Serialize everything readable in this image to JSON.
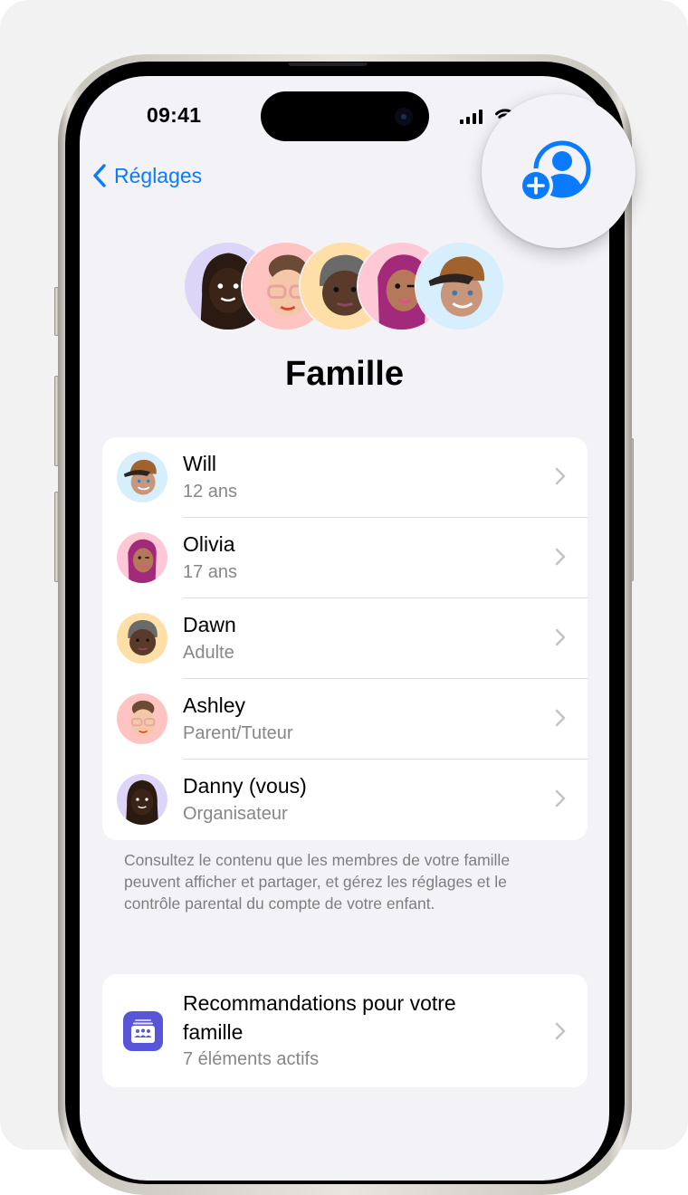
{
  "status_bar": {
    "time": "09:41",
    "icons": [
      "signal-icon",
      "wifi-icon"
    ]
  },
  "nav": {
    "back_label": "Réglages",
    "back_icon": "chevron-left-icon",
    "add_member_icon": "person-add-icon"
  },
  "header": {
    "title": "Famille",
    "avatar_backgrounds": [
      "#ddd5f7",
      "#ffc4c1",
      "#ffdfa8",
      "#ffc8d6",
      "#d7eefc"
    ]
  },
  "members": [
    {
      "name": "Will",
      "role": "12 ans",
      "avatar_bg": "#d7eefc"
    },
    {
      "name": "Olivia",
      "role": "17 ans",
      "avatar_bg": "#ffc8d6"
    },
    {
      "name": "Dawn",
      "role": "Adulte",
      "avatar_bg": "#ffdfa8"
    },
    {
      "name": "Ashley",
      "role": "Parent/Tuteur",
      "avatar_bg": "#ffc4c1"
    },
    {
      "name": "Danny (vous)",
      "role": "Organisateur",
      "avatar_bg": "#ddd5f7"
    }
  ],
  "footnote": "Consultez le contenu que les membres de votre famille peuvent afficher et partager, et gérez les réglages et le contrôle parental du compte de votre enfant.",
  "recommendations": {
    "title": "Recommandations pour votre famille",
    "subtitle": "7 éléments actifs",
    "icon": "family-checklist-icon"
  },
  "colors": {
    "accent": "#0a7aff",
    "background": "#f2f2f7",
    "secondary_text": "#86868b",
    "rec_icon_bg": "#5856d6"
  }
}
